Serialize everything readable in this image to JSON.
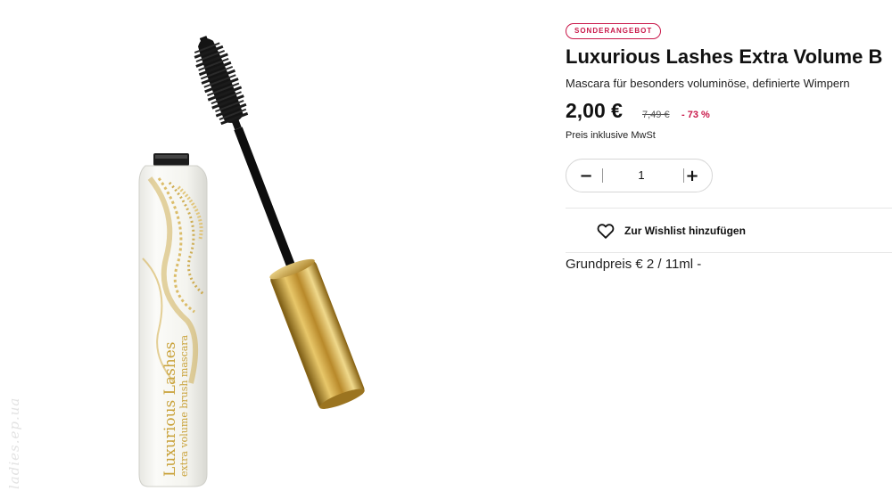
{
  "product": {
    "badge": "SONDERANGEBOT",
    "title": "Luxurious Lashes Extra Volume B",
    "subtitle": "Mascara für besonders voluminöse, definierte Wimpern",
    "price_current": "2,00 €",
    "price_old": "7,49 €",
    "discount": "- 73 %",
    "vat_note": "Preis inklusive MwSt",
    "quantity": "1",
    "wishlist_label": "Zur Wishlist hinzufügen",
    "unit_price": "Grundpreis € 2 / 11ml -"
  },
  "image": {
    "tube_text_line1": "Luxurious Lashes",
    "tube_text_line2": "extra volume brush mascara",
    "watermark": "ladies.ep.ua"
  },
  "colors": {
    "accent": "#c9184a",
    "gold": "#c9a23a",
    "tube": "#f4f4ef"
  }
}
